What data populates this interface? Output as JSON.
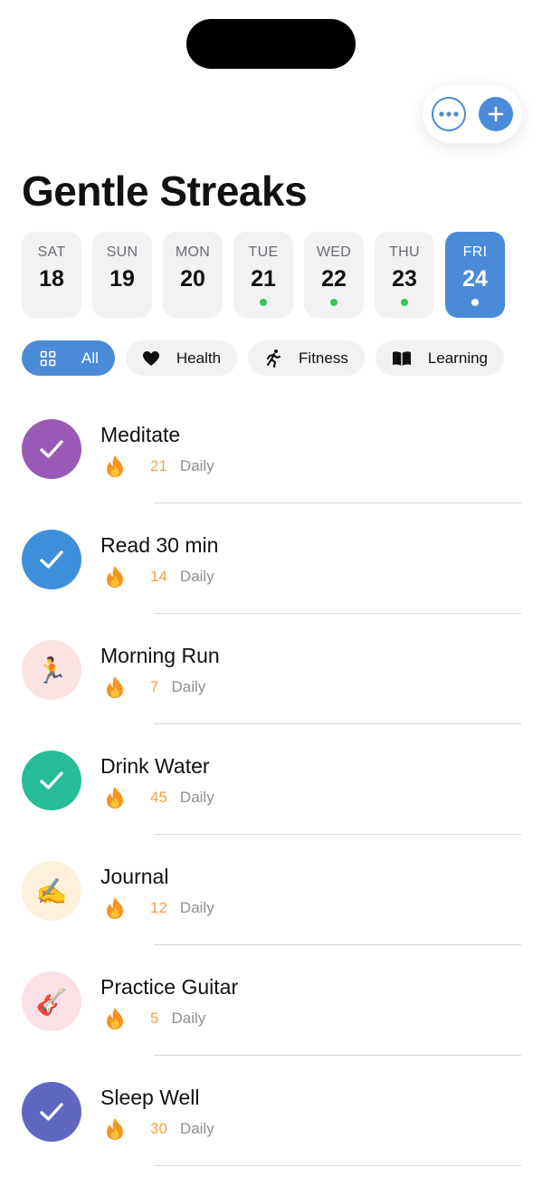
{
  "app": {
    "title": "Gentle Streaks"
  },
  "colors": {
    "accent": "#4a8bd8",
    "streak": "#f5a044",
    "done_dot": "#34c759"
  },
  "days": [
    {
      "dow": "SAT",
      "num": "18",
      "dot": false,
      "selected": false
    },
    {
      "dow": "SUN",
      "num": "19",
      "dot": false,
      "selected": false
    },
    {
      "dow": "MON",
      "num": "20",
      "dot": false,
      "selected": false
    },
    {
      "dow": "TUE",
      "num": "21",
      "dot": true,
      "selected": false
    },
    {
      "dow": "WED",
      "num": "22",
      "dot": true,
      "selected": false
    },
    {
      "dow": "THU",
      "num": "23",
      "dot": true,
      "selected": false
    },
    {
      "dow": "FRI",
      "num": "24",
      "dot": true,
      "selected": true
    }
  ],
  "filters": [
    {
      "label": "All",
      "icon": "grid-icon",
      "active": true
    },
    {
      "label": "Health",
      "icon": "heart-icon",
      "active": false
    },
    {
      "label": "Fitness",
      "icon": "running-figure-icon",
      "active": false
    },
    {
      "label": "Learning",
      "icon": "book-icon",
      "active": false
    }
  ],
  "habits": [
    {
      "name": "Meditate",
      "streak": "21",
      "frequency": "Daily",
      "status": "done",
      "color": "#9b59b6",
      "icon": "checkmark-icon"
    },
    {
      "name": "Read 30 min",
      "streak": "14",
      "frequency": "Daily",
      "status": "done",
      "color": "#3d8fd9",
      "icon": "checkmark-icon"
    },
    {
      "name": "Morning Run",
      "streak": "7",
      "frequency": "Daily",
      "status": "pending",
      "color": "#fbe3e1",
      "icon": "runner-emoji-icon",
      "emoji": "🏃"
    },
    {
      "name": "Drink Water",
      "streak": "45",
      "frequency": "Daily",
      "status": "done",
      "color": "#26bc97",
      "icon": "checkmark-icon"
    },
    {
      "name": "Journal",
      "streak": "12",
      "frequency": "Daily",
      "status": "pending",
      "color": "#fdf0dc",
      "icon": "writing-hand-emoji-icon",
      "emoji": "✍️"
    },
    {
      "name": "Practice Guitar",
      "streak": "5",
      "frequency": "Daily",
      "status": "pending",
      "color": "#fde0e6",
      "icon": "guitar-emoji-icon",
      "emoji": "🎸"
    },
    {
      "name": "Sleep Well",
      "streak": "30",
      "frequency": "Daily",
      "status": "done",
      "color": "#5f67c1",
      "icon": "checkmark-icon"
    }
  ]
}
